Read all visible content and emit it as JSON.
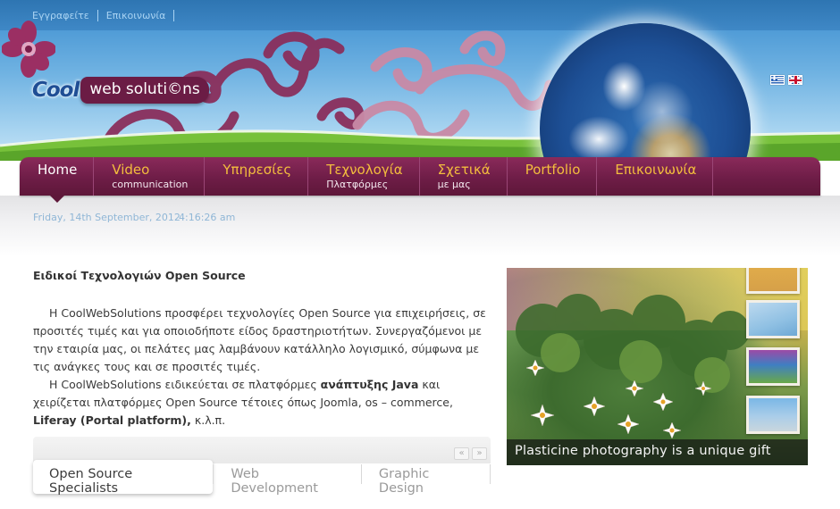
{
  "header": {
    "top_links": [
      "Εγγραφείτε",
      "Επικοινωνία"
    ],
    "logo": {
      "prefix": "Cool",
      "badge": "web soluti©ns"
    },
    "flags": [
      "greek-flag-icon",
      "uk-flag-icon"
    ]
  },
  "nav": {
    "items": [
      {
        "label": "Home",
        "sub": ""
      },
      {
        "label": "Video",
        "sub": "communication"
      },
      {
        "label": "Υπηρεσίες",
        "sub": ""
      },
      {
        "label": "Τεχνολογία",
        "sub": "Πλατφόρμες"
      },
      {
        "label": "Σχετικά",
        "sub": "με μας"
      },
      {
        "label": "Portfolio",
        "sub": ""
      },
      {
        "label": "Επικοινωνία",
        "sub": ""
      }
    ],
    "active_index": 0
  },
  "datebar": {
    "date": "Friday, 14th September, 2012",
    "time": "4:16:26 am"
  },
  "content": {
    "heading": "Ειδικοί Τεχνολογιών Open Source",
    "p1": "Η CoolWebSolutions προσφέρει τεχνολογίες Open Source για επιχειρήσεις, σε προσιτές τιμές και για οποιοδήποτε είδος δραστηριοτήτων. Συνεργαζόμενοι με την εταιρία μας, οι πελάτες μας λαμβάνουν κατάλληλο λογισμικό, σύμφωνα με τις ανάγκες τους και σε προσιτές τιμές.",
    "p2_a": "Η CoolWebSolutions ειδικεύεται σε πλατφόρμες ",
    "p2_b": "ανάπτυξης Java",
    "p2_c": " και χειρίζεται πλατφόρμες Open Source τέτοιες όπως Joomla, os – commerce, ",
    "p2_d": "Liferay (Portal platform),",
    "p2_e": " κ.λ.π."
  },
  "tabs": {
    "items": [
      "Open Source Specialists",
      "Web Development",
      "Graphic Design"
    ],
    "active_index": 0,
    "prev_arrow": "«",
    "next_arrow": "»"
  },
  "slideshow": {
    "caption": "Plasticine photography is a unique gift",
    "thumbnails": 4
  }
}
